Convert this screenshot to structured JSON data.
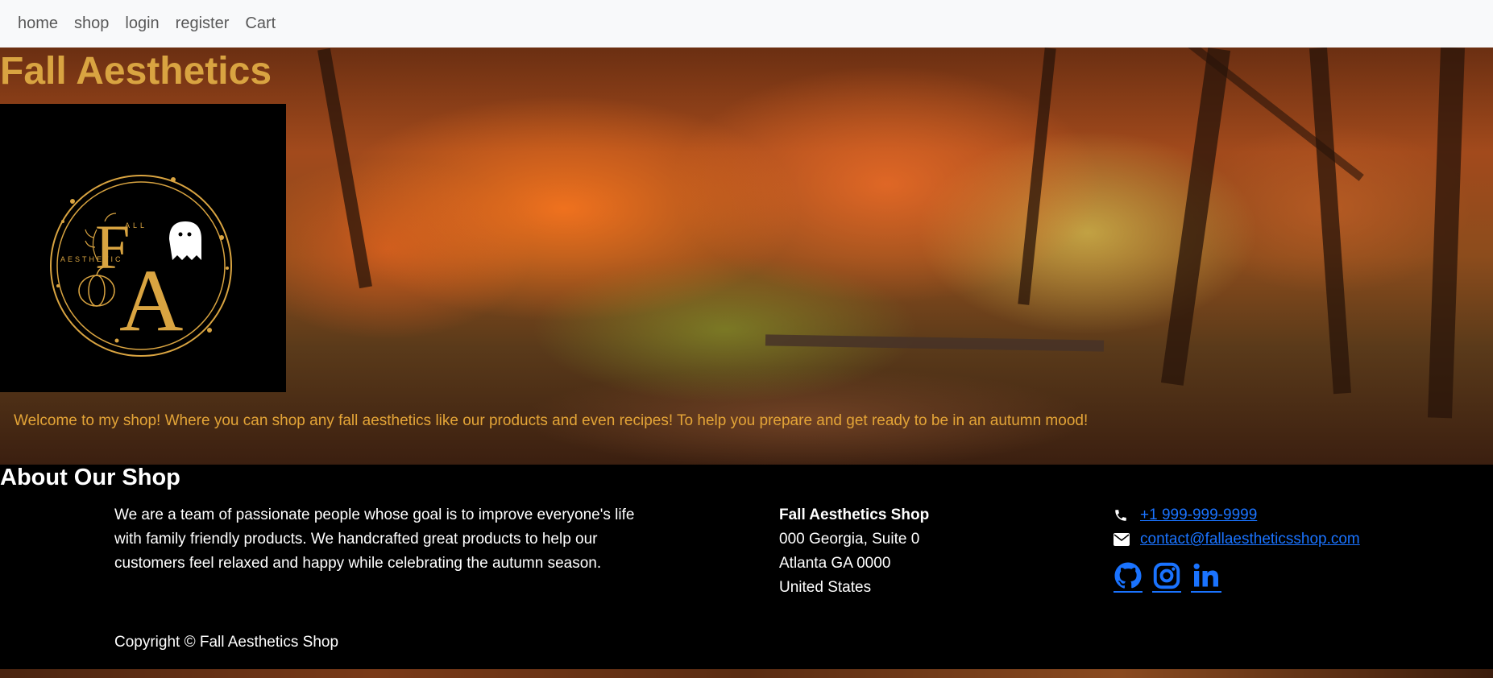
{
  "nav": {
    "items": [
      {
        "label": "home"
      },
      {
        "label": "shop"
      },
      {
        "label": "login"
      },
      {
        "label": "register"
      },
      {
        "label": "Cart"
      }
    ]
  },
  "hero": {
    "title": "Fall Aesthetics",
    "welcome": "Welcome to my shop! Where you can shop any fall aesthetics like our products and even recipes! To help you prepare and get ready to be in an autumn mood!",
    "logo": {
      "letters_big": "FA",
      "word_top": "ALL",
      "word_side": "AESTHETIC",
      "color": "#d9a441"
    }
  },
  "about": {
    "title": "About Our Shop",
    "text": "We are a team of passionate people whose goal is to improve everyone's life with family friendly products. We handcrafted great products to help our customers feel relaxed and happy while celebrating the autumn season.",
    "address": {
      "name": "Fall Aesthetics Shop",
      "line1": "000 Georgia, Suite 0",
      "line2": "Atlanta GA 0000",
      "line3": "United States"
    },
    "contact": {
      "phone": "+1 999-999-9999",
      "email": "contact@fallaestheticsshop.com"
    },
    "socials": [
      "github-icon",
      "instagram-icon",
      "linkedin-icon"
    ],
    "copyright": "Copyright © Fall Aesthetics Shop"
  },
  "colors": {
    "accent": "#d9a441",
    "link": "#1a73ff",
    "navbar_bg": "#f8f9fa"
  }
}
